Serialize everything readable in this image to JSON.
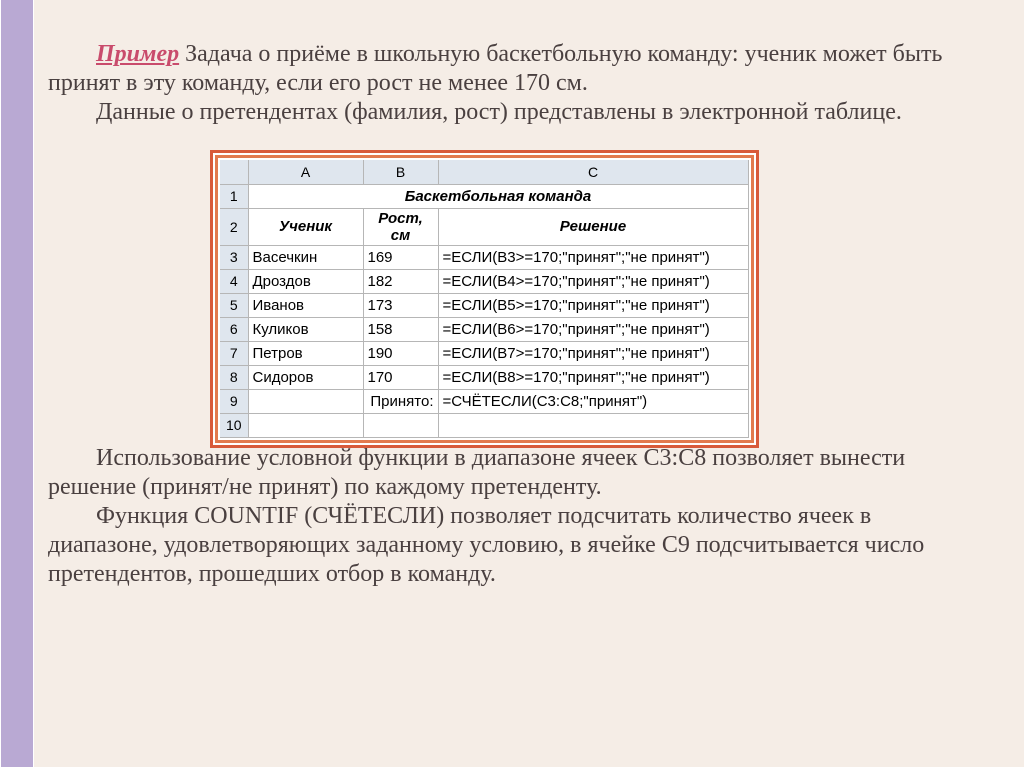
{
  "text": {
    "example_label": "Пример",
    "p1_after_label": " Задача о приёме в школьную баскетбольную команду: ученик может быть принят в эту команду, если его рост не менее 170 см.",
    "p2": "Данные о претендентах (фамилия, рост) представлены в электронной таблице.",
    "p3": "Использование условной функции в диапазоне ячеек С3:С8 позволяет вынести решение (принят/не принят) по каждому претенденту.",
    "p4": "Функция COUNTIF (СЧЁТЕСЛИ) позволяет подсчитать количество ячеек в диапазоне, удовлетворяющих заданному условию, в ячейке С9 подсчитывается число претендентов, прошедших отбор в команду."
  },
  "spreadsheet": {
    "columns": [
      "A",
      "B",
      "C"
    ],
    "title_row": {
      "num": "1",
      "title": "Баскетбольная команда"
    },
    "header_row": {
      "num": "2",
      "a": "Ученик",
      "b": "Рост, см",
      "c": "Решение"
    },
    "data": [
      {
        "num": "3",
        "a": "Васечкин",
        "b": "169",
        "c": "=ЕСЛИ(B3>=170;\"принят\";\"не принят\")"
      },
      {
        "num": "4",
        "a": "Дроздов",
        "b": "182",
        "c": "=ЕСЛИ(B4>=170;\"принят\";\"не принят\")"
      },
      {
        "num": "5",
        "a": "Иванов",
        "b": "173",
        "c": "=ЕСЛИ(B5>=170;\"принят\";\"не принят\")"
      },
      {
        "num": "6",
        "a": "Куликов",
        "b": "158",
        "c": "=ЕСЛИ(B6>=170;\"принят\";\"не принят\")"
      },
      {
        "num": "7",
        "a": "Петров",
        "b": "190",
        "c": "=ЕСЛИ(B7>=170;\"принят\";\"не принят\")"
      },
      {
        "num": "8",
        "a": "Сидоров",
        "b": "170",
        "c": "=ЕСЛИ(B8>=170;\"принят\";\"не принят\")"
      }
    ],
    "summary_row": {
      "num": "9",
      "a": "",
      "b": "Принято:",
      "c": "=СЧЁТЕСЛИ(C3:C8;\"принят\")"
    },
    "empty_row": {
      "num": "10"
    }
  }
}
